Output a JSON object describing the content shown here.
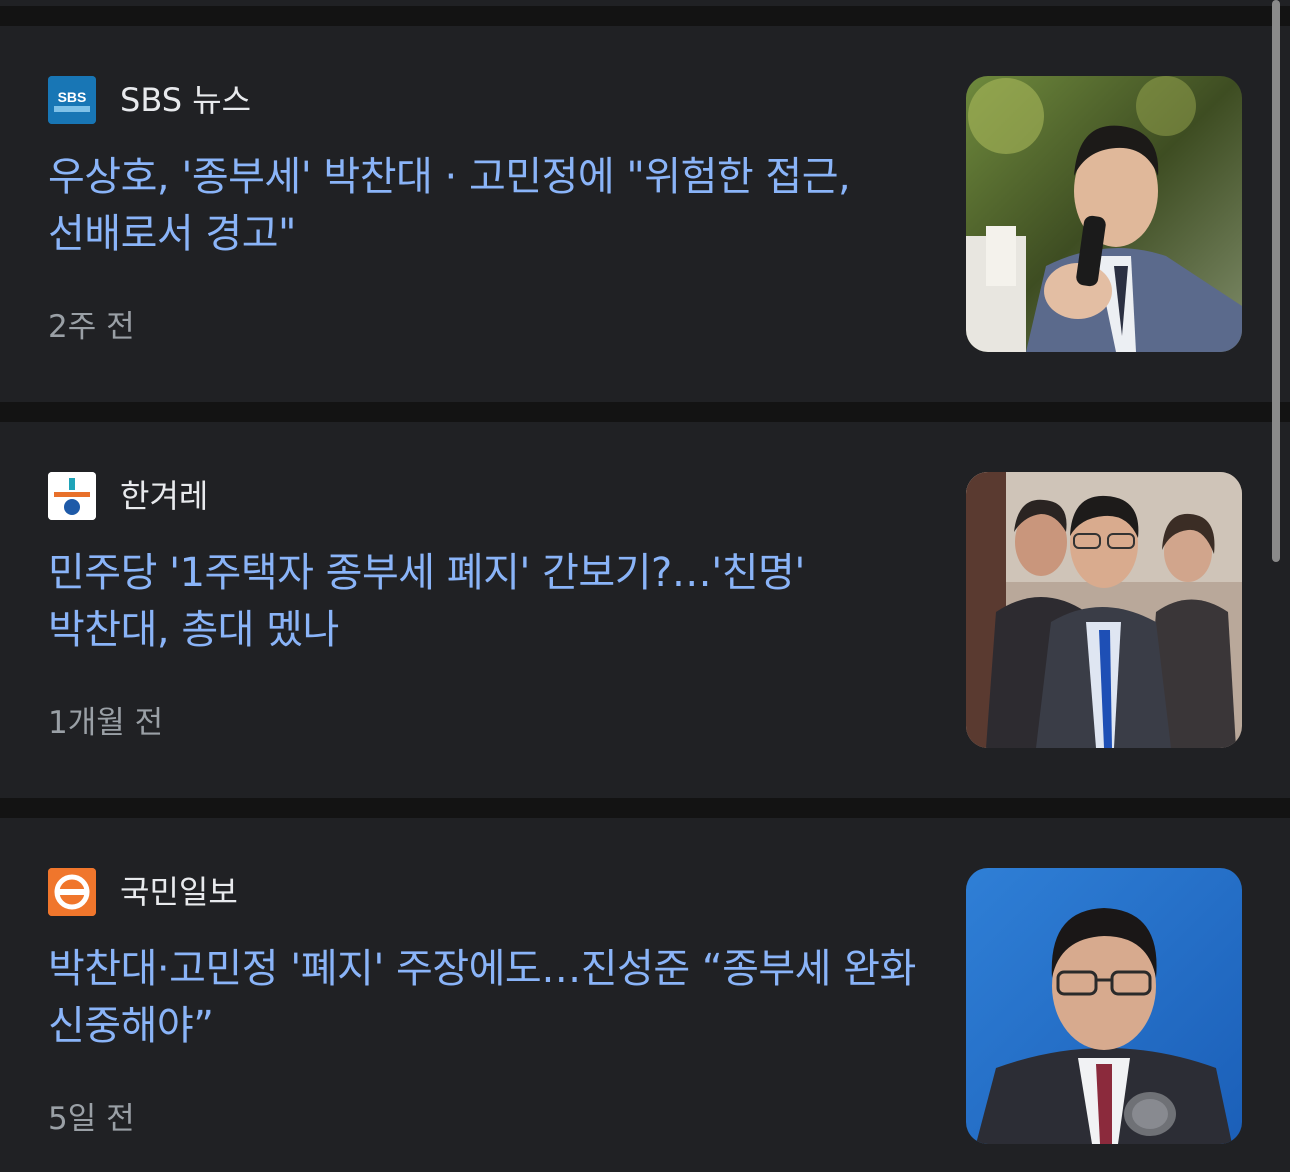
{
  "colors": {
    "page_bg": "#131313",
    "card_bg": "#202124",
    "headline": "#8ab4f8",
    "source_name": "#e8eaed",
    "time": "#9aa0a6"
  },
  "articles": [
    {
      "source": "SBS 뉴스",
      "logo_icon": "sbs-news-logo",
      "logo_text": "SBS",
      "headline": "우상호, '종부세' 박찬대 · 고민정에 \"위험한 접근, 선배로서 경고\"",
      "time": "2주 전",
      "thumbnail_icon": "photo-man-speaking-microphone"
    },
    {
      "source": "한겨레",
      "logo_icon": "hankyoreh-logo",
      "headline": "민주당 '1주택자 종부세 폐지' 간보기?…'친명' 박찬대, 총대 멨나",
      "time": "1개월 전",
      "thumbnail_icon": "photo-politicians-group"
    },
    {
      "source": "국민일보",
      "logo_icon": "kukmin-ilbo-logo",
      "headline": "박찬대·고민정 '폐지' 주장에도…진성준 “종부세 완화 신중해야”",
      "time": "5일 전",
      "thumbnail_icon": "photo-man-glasses-blue-background"
    }
  ]
}
